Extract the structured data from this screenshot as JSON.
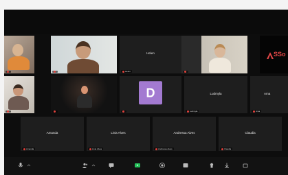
{
  "participants": {
    "row1": [
      {
        "name": "",
        "label": ""
      },
      {
        "name": "",
        "label": ""
      },
      {
        "name": "Helen",
        "label": "Helen"
      },
      {
        "name": "",
        "label": ""
      },
      {
        "name": "",
        "label": ""
      }
    ],
    "row2": [
      {
        "name": "",
        "label": ""
      },
      {
        "name": "",
        "label": ""
      },
      {
        "name": "",
        "label": "",
        "avatar_letter": "D",
        "avatar_color": "#a37ad1"
      },
      {
        "name": "Ludmyla",
        "label": "Ludmyla"
      },
      {
        "name": "Ama",
        "label": "Ama"
      }
    ],
    "row3": [
      {
        "name": "Amanda",
        "label": "Amanda"
      },
      {
        "name": "Livia Alves",
        "label": "Livia Alves"
      },
      {
        "name": "Andressa Alves",
        "label": "Andressa Alves"
      },
      {
        "name": "Claudia",
        "label": "Claudia"
      }
    ]
  },
  "logo": {
    "text": "SSo",
    "color": "#e24646"
  },
  "colors": {
    "active_speaker_border": "#c9d44c",
    "mic_off": "#e0413b",
    "background": "#0d0d0d",
    "tile": "#222222"
  },
  "toolbar": {
    "icons": [
      "microphone-icon",
      "chevron-up-icon",
      "participants-icon",
      "chat-icon",
      "share-screen-icon",
      "record-icon",
      "reactions-icon",
      "apps-icon",
      "leave-icon"
    ]
  }
}
